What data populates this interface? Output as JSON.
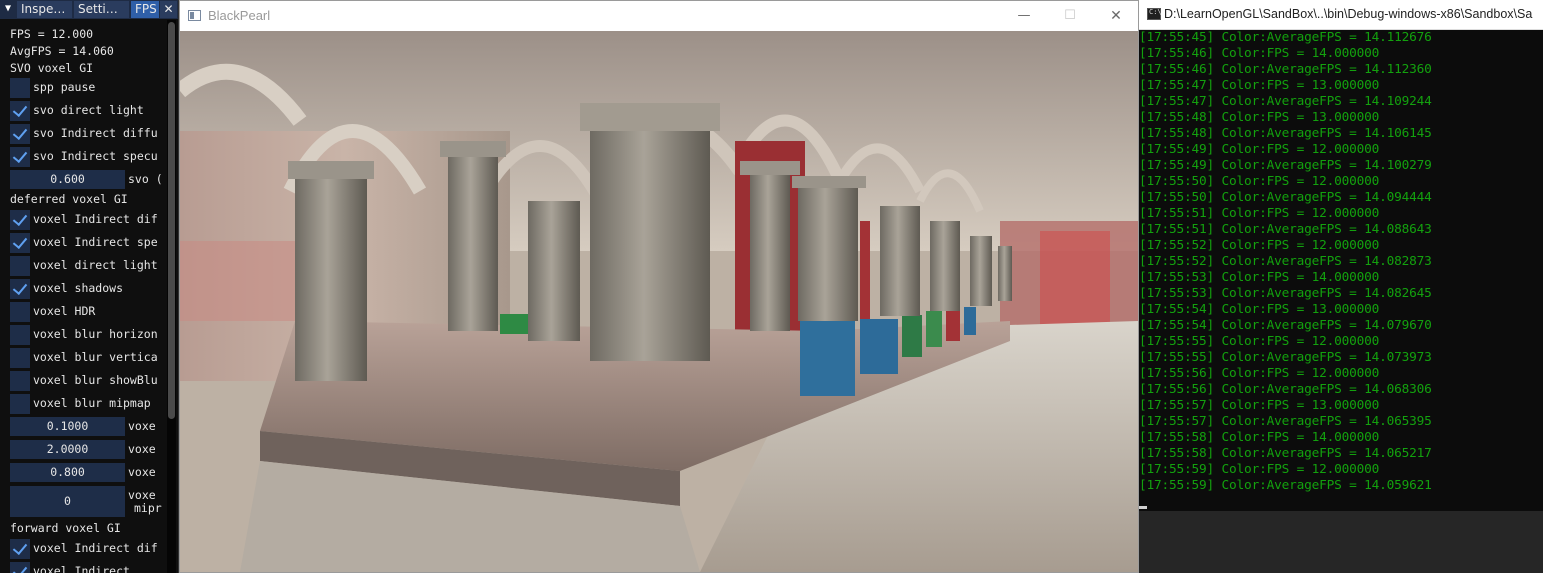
{
  "imgui": {
    "tabs": [
      {
        "label": "Inspe…",
        "active": false
      },
      {
        "label": "Setti…",
        "active": false
      },
      {
        "label": "FPS",
        "active": true
      }
    ],
    "fps": "FPS = 12.000",
    "avgfps": "AvgFPS = 14.060",
    "section_svo": "SVO voxel GI",
    "spp_pause": "spp pause",
    "svo_direct_light": "svo direct light",
    "svo_indirect_diffuse": "svo Indirect diffu",
    "svo_indirect_specular": "svo Indirect specu",
    "svo_slider_value": "0.600",
    "svo_slider_label": "svo (",
    "section_deferred": "deferred voxel GI",
    "voxel_indirect_diffuse": "voxel Indirect dif",
    "voxel_indirect_specular": "voxel Indirect spe",
    "voxel_direct_light": "voxel direct light",
    "voxel_shadows": "voxel shadows",
    "voxel_hdr": "voxel HDR",
    "voxel_blur_horizontal": "voxel blur horizon",
    "voxel_blur_vertical": "voxel blur vertica",
    "voxel_blur_showblur": "voxel blur showBlu",
    "voxel_blur_mipmap": "voxel blur mipmap",
    "slider1_value": "0.1000",
    "slider1_label": "voxe",
    "slider2_value": "2.0000",
    "slider2_label": "voxe",
    "slider3_value": "0.800",
    "slider3_label": "voxe",
    "slider4_value": "0",
    "slider4_label1": "voxe",
    "slider4_label2": "mipr",
    "section_forward": "forward voxel GI",
    "fwd_voxel_indirect_diffuse": "voxel Indirect dif",
    "fwd_voxel_partial": "voxel Indirect"
  },
  "blackpearl": {
    "title": "BlackPearl",
    "minimize": "—",
    "maximize": "☐",
    "close": "✕"
  },
  "console": {
    "title": "D:\\LearnOpenGL\\SandBox\\..\\bin\\Debug-windows-x86\\Sandbox\\Sa",
    "lines": [
      "[17:55:45] Color:AverageFPS = 14.112676",
      "[17:55:46] Color:FPS = 14.000000",
      "[17:55:46] Color:AverageFPS = 14.112360",
      "[17:55:47] Color:FPS = 13.000000",
      "[17:55:47] Color:AverageFPS = 14.109244",
      "[17:55:48] Color:FPS = 13.000000",
      "[17:55:48] Color:AverageFPS = 14.106145",
      "[17:55:49] Color:FPS = 12.000000",
      "[17:55:49] Color:AverageFPS = 14.100279",
      "[17:55:50] Color:FPS = 12.000000",
      "[17:55:50] Color:AverageFPS = 14.094444",
      "[17:55:51] Color:FPS = 12.000000",
      "[17:55:51] Color:AverageFPS = 14.088643",
      "[17:55:52] Color:FPS = 12.000000",
      "[17:55:52] Color:AverageFPS = 14.082873",
      "[17:55:53] Color:FPS = 14.000000",
      "[17:55:53] Color:AverageFPS = 14.082645",
      "[17:55:54] Color:FPS = 13.000000",
      "[17:55:54] Color:AverageFPS = 14.079670",
      "[17:55:55] Color:FPS = 12.000000",
      "[17:55:55] Color:AverageFPS = 14.073973",
      "[17:55:56] Color:FPS = 12.000000",
      "[17:55:56] Color:AverageFPS = 14.068306",
      "[17:55:57] Color:FPS = 13.000000",
      "[17:55:57] Color:AverageFPS = 14.065395",
      "[17:55:58] Color:FPS = 14.000000",
      "[17:55:58] Color:AverageFPS = 14.065217",
      "[17:55:59] Color:FPS = 12.000000",
      "[17:55:59] Color:AverageFPS = 14.059621"
    ]
  },
  "colors": {
    "console_text": "#13a10e",
    "imgui_accent": "#5fa0f0",
    "imgui_frame": "#1e2d48"
  }
}
